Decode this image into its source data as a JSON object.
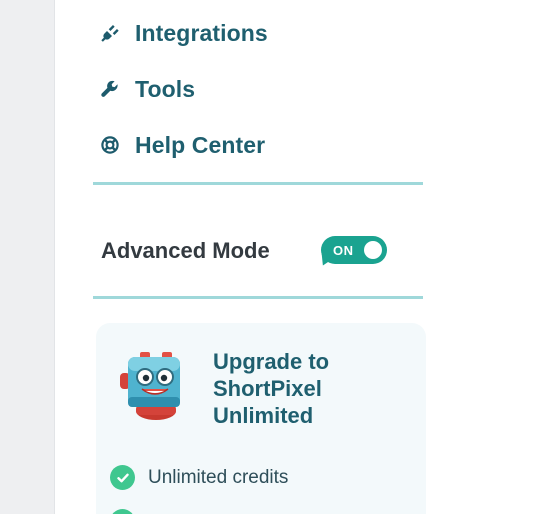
{
  "menu": {
    "items": [
      {
        "label": "Integrations",
        "icon": "plug-icon"
      },
      {
        "label": "Tools",
        "icon": "wrench-icon"
      },
      {
        "label": "Help Center",
        "icon": "lifebuoy-icon"
      }
    ]
  },
  "advanced_mode": {
    "label": "Advanced Mode",
    "toggle_text": "ON",
    "enabled": true,
    "toggle_color": "#1aa390"
  },
  "upgrade_card": {
    "title_line1": "Upgrade to",
    "title_line2": "ShortPixel",
    "title_line3": "Unlimited",
    "features": [
      {
        "text": "Unlimited credits"
      },
      {
        "text": ""
      }
    ],
    "check_color": "#3fc78f"
  },
  "colors": {
    "accent_text": "#1f5f6f",
    "divider": "#9fd8da",
    "card_bg": "#f3f9fb"
  }
}
